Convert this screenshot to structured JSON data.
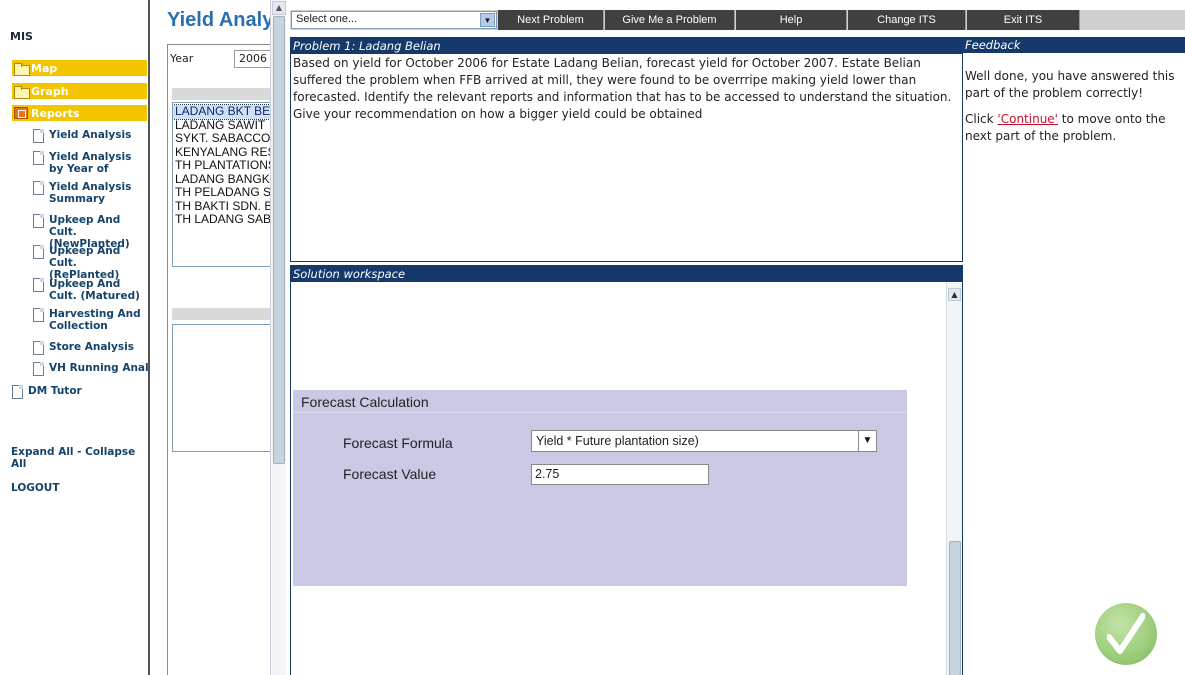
{
  "nav": {
    "root": "MIS",
    "categories": [
      {
        "label": "Map",
        "icon": "folder-icon"
      },
      {
        "label": "Graph",
        "icon": "folder-icon"
      },
      {
        "label": "Reports",
        "icon": "report-icon"
      }
    ],
    "reports": [
      "Yield Analysis",
      "Yield Analysis by Year of Planting",
      "Yield Analysis Summary",
      "Upkeep And Cult. (NewPlanted)",
      "Upkeep And Cult. (RePlanted)",
      "Upkeep And Cult. (Matured)",
      "Harvesting And Collection",
      "Store Analysis",
      "VH Running Analysis"
    ],
    "dm_tutor": "DM Tutor",
    "expand_collapse": "Expand All - Collapse All",
    "logout": "LOGOUT"
  },
  "middle": {
    "title": "Yield Analysis",
    "year_label": "Year",
    "year_value": "2006",
    "estates": [
      "LADANG BKT BESAR",
      "LADANG SAWIT",
      "SYKT. SABACCO",
      "KENYALANG RESOURCES",
      "TH PLANTATIONS",
      "LADANG BANGKIT",
      "TH PELADANG SDN",
      "TH BAKTI SDN. BHD",
      "TH LADANG SABAH"
    ]
  },
  "toolbar": {
    "select_placeholder": "Select one...",
    "next_problem": "Next Problem",
    "give_problem": "Give Me a Problem",
    "help": "Help",
    "change_its": "Change ITS",
    "exit_its": "Exit ITS"
  },
  "problem": {
    "header": "Problem 1: Ladang Belian",
    "text": "Based on yield for October 2006 for Estate Ladang Belian, forecast yield for October 2007. Estate Belian suffered the problem when FFB arrived at mill, they were found to be overrripe making yield lower than forecasted. Identify the relevant reports and information that has to be accessed to understand the situation. Give your recommendation on how a bigger yield could be obtained"
  },
  "workspace": {
    "header": "Solution workspace",
    "section_title": "Forecast Calculation",
    "formula_label": "Forecast Formula",
    "formula_value": "Yield * Future plantation size)",
    "value_label": "Forecast Value",
    "value_value": "2.75"
  },
  "feedback": {
    "header": "Feedback",
    "message": "Well done, you have answered this part of the problem correctly!",
    "click_prefix": "Click ",
    "continue_link": "'Continue'",
    "click_suffix": " to move onto the next part of the problem."
  },
  "colors": {
    "panel_header": "#16396b",
    "nav_category": "#f2c500",
    "forecast_bg": "#c9c9e6",
    "toolbar_button": "#404040",
    "success_check": "#8fc86d"
  }
}
